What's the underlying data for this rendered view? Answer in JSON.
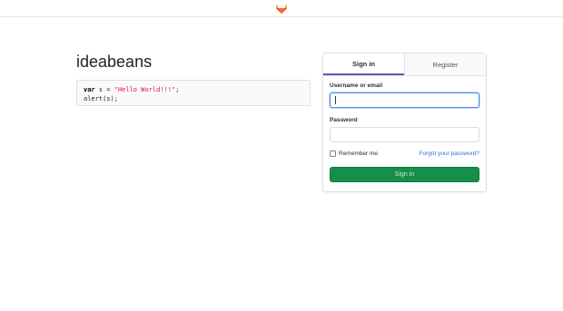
{
  "header": {
    "logo_icon": "gitlab-fox-icon"
  },
  "main": {
    "title": "ideabeans",
    "code": {
      "line1_kw": "var",
      "line1_mid": " s = ",
      "line1_str": "\"Hello World!!!\"",
      "line1_end": ";",
      "line2": "alert(s);"
    }
  },
  "auth": {
    "tabs": [
      {
        "label": "Sign in",
        "active": true
      },
      {
        "label": "Register",
        "active": false
      }
    ],
    "username_label": "Username or email",
    "username_value": "",
    "password_label": "Password",
    "password_value": "",
    "remember_label": "Remember me",
    "forgot_label": "Forgot your password?",
    "submit_label": "Sign in"
  },
  "colors": {
    "accent_tab": "#6b4fbb",
    "link": "#1f78d1",
    "submit_bg": "#168f48"
  }
}
